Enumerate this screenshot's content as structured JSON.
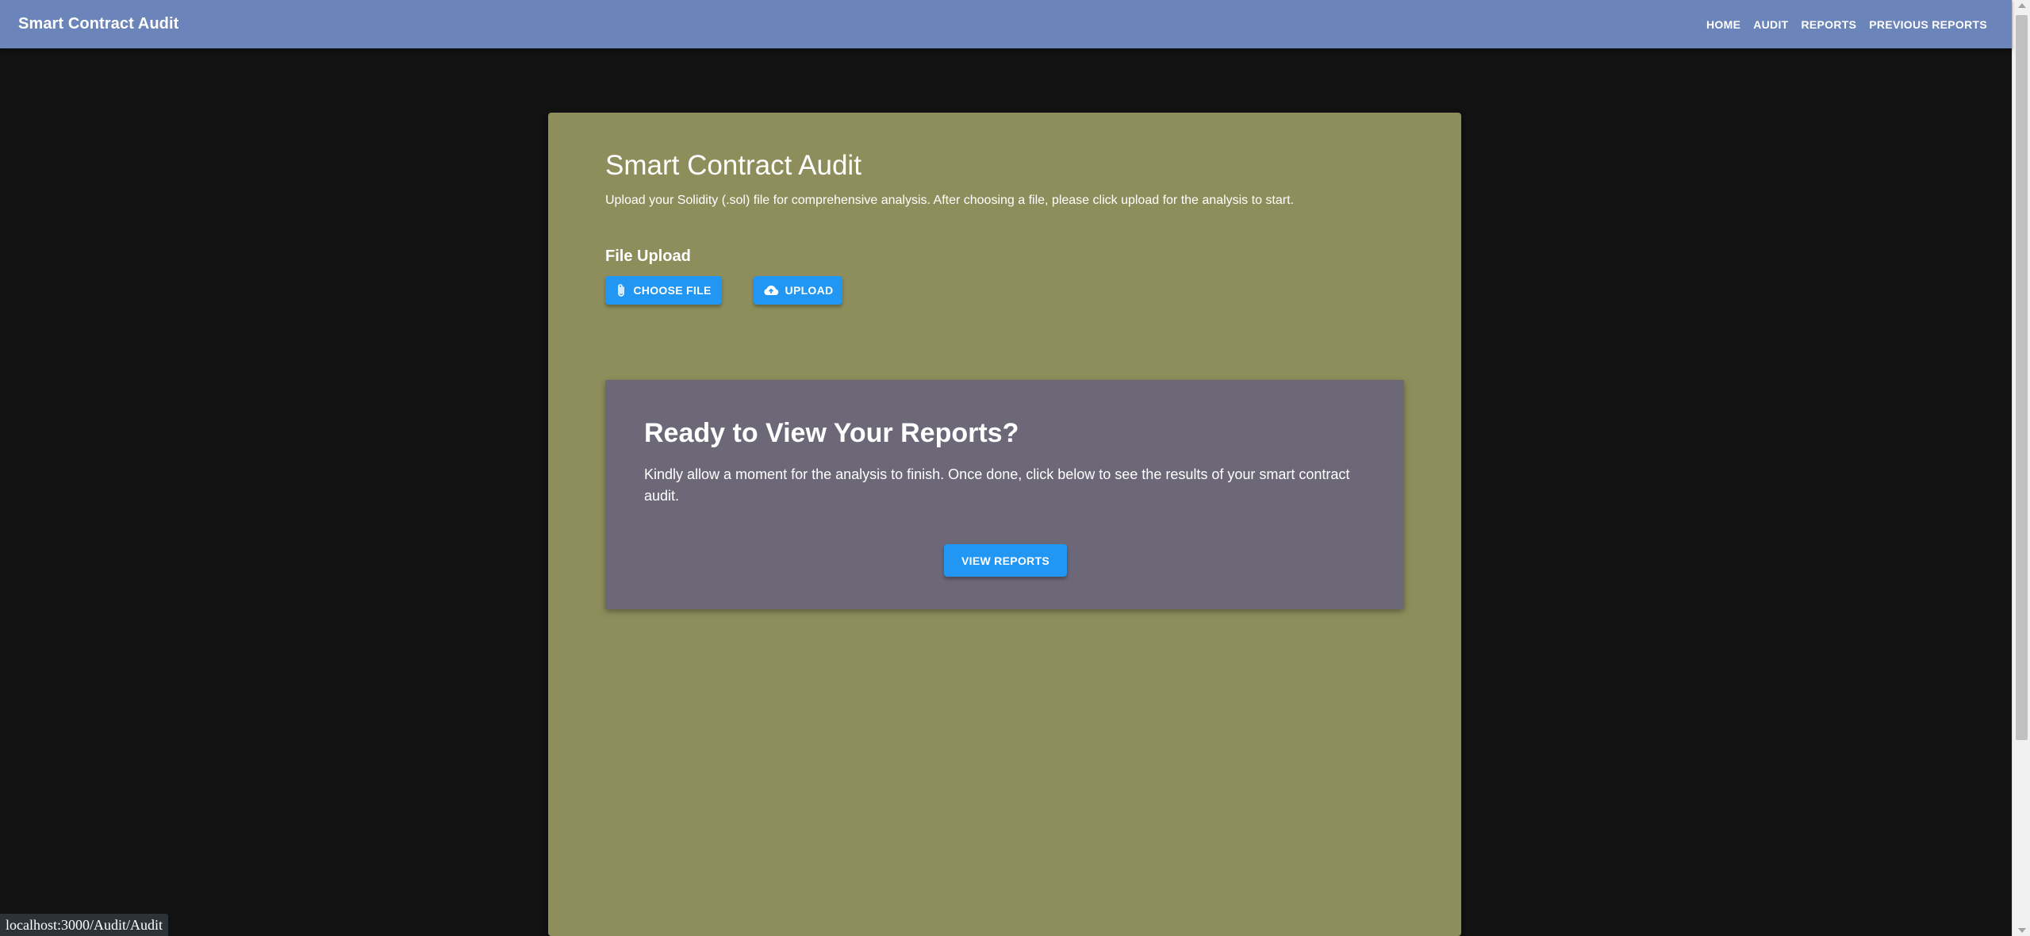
{
  "appbar": {
    "brand": "Smart Contract Audit",
    "nav": [
      "HOME",
      "AUDIT",
      "REPORTS",
      "PREVIOUS REPORTS"
    ]
  },
  "card": {
    "title": "Smart Contract Audit",
    "subtitle": "Upload your Solidity (.sol) file for comprehensive analysis. After choosing a file, please click upload for the analysis to start.",
    "upload_label": "File Upload",
    "choose_file_label": "CHOOSE FILE",
    "choose_file_icon": "paperclip-icon",
    "upload_label_btn": "UPLOAD",
    "upload_icon": "cloud-upload-icon"
  },
  "reports_panel": {
    "title": "Ready to View Your Reports?",
    "text": "Kindly allow a moment for the analysis to finish. Once done, click below to see the results of your smart contract audit.",
    "button": "VIEW REPORTS"
  },
  "status_bar": {
    "url": "localhost:3000/Audit/Audit"
  },
  "colors": {
    "appbar": "#6b84b9",
    "background": "#121212",
    "card": "#8e8e5c",
    "panel": "#6c6877",
    "button": "#2196f3"
  }
}
